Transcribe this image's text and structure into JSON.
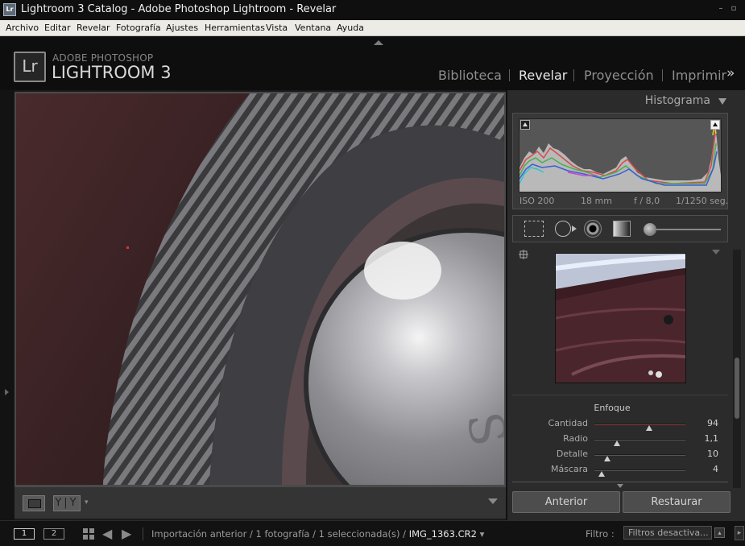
{
  "window": {
    "title": "Lightroom 3 Catalog - Adobe Photoshop Lightroom - Revelar",
    "app_icon_text": "Lr"
  },
  "menu": [
    "Archivo",
    "Editar",
    "Revelar",
    "Fotografía",
    "Ajustes",
    "Herramientas",
    "Vista",
    "Ventana",
    "Ayuda"
  ],
  "brand": {
    "logo_text": "Lr",
    "line1": "ADOBE PHOTOSHOP",
    "line2": "LIGHTROOM 3"
  },
  "modules": [
    {
      "label": "Biblioteca",
      "active": false
    },
    {
      "label": "Revelar",
      "active": true
    },
    {
      "label": "Proyección",
      "active": false
    },
    {
      "label": "Imprimir",
      "active": false
    }
  ],
  "modules_more": "»",
  "toolbar": {
    "yy_label": "Y|Y"
  },
  "histogram": {
    "title": "Histograma",
    "exif": {
      "iso": "ISO 200",
      "focal_length": "18 mm",
      "aperture": "f / 8,0",
      "shutter": "1/1250 seg."
    }
  },
  "detail": {
    "section_title": "Enfoque",
    "sliders": [
      {
        "label": "Cantidad",
        "value": "94",
        "fraction": 0.6
      },
      {
        "label": "Radio",
        "value": "1,1",
        "fraction": 0.25
      },
      {
        "label": "Detalle",
        "value": "10",
        "fraction": 0.14
      },
      {
        "label": "Máscara",
        "value": "4",
        "fraction": 0.08
      }
    ]
  },
  "buttons": {
    "previous": "Anterior",
    "reset": "Restaurar"
  },
  "filmstrip": {
    "screen1": "1",
    "screen2": "2",
    "breadcrumb": "Importación anterior / 1 fotografía / 1 seleccionada(s) /",
    "filename": "IMG_1363.CR2",
    "filename_arrow": "▾",
    "filter_label": "Filtro :",
    "filter_value": "Filtros desactiva..."
  },
  "colors": {
    "accent": "#e6e6e6",
    "panel": "#2b2b2b",
    "background": "#1b1b1b"
  }
}
